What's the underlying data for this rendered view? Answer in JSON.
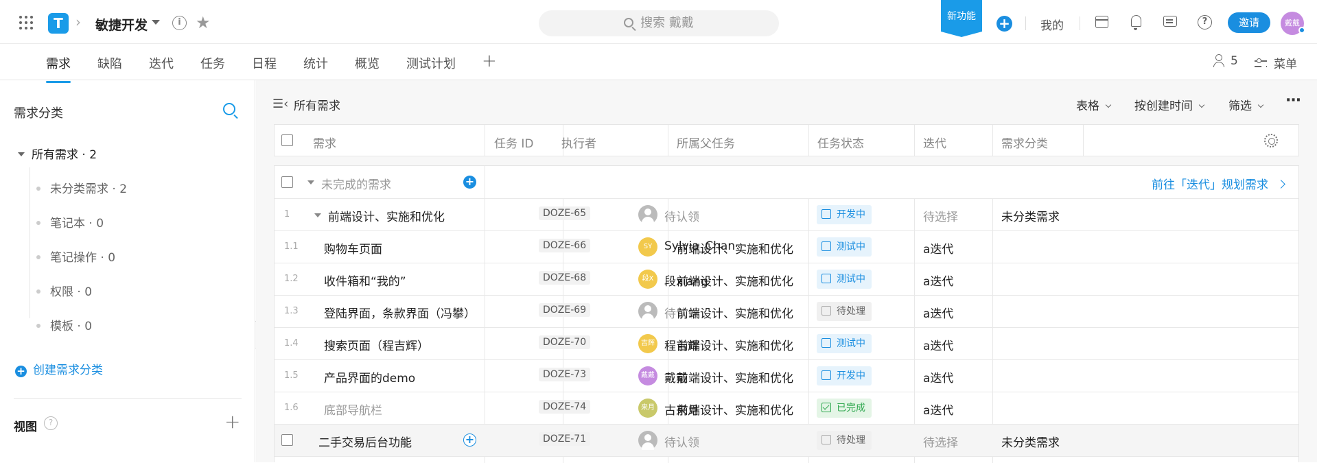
{
  "topbar": {
    "logo_letter": "T",
    "project_name": "敏捷开发",
    "search_placeholder": "搜索 戴戴",
    "new_feature_badge": "新功能",
    "mine_label": "我的",
    "invite_label": "邀请",
    "user_avatar_text": "戴戴"
  },
  "nav": {
    "tabs": [
      "需求",
      "缺陷",
      "迭代",
      "任务",
      "日程",
      "统计",
      "概览",
      "测试计划"
    ],
    "active_tab": "需求",
    "member_count": "5",
    "menu_label": "菜单"
  },
  "sidebar": {
    "title": "需求分类",
    "root": "所有需求 · 2",
    "items": [
      "未分类需求 · 2",
      "笔记本 · 0",
      "笔记操作 · 0",
      "权限 · 0",
      "模板 · 0"
    ],
    "create_label": "创建需求分类",
    "views_label": "视图"
  },
  "main": {
    "title": "所有需求",
    "view_mode": "表格",
    "sort_label": "按创建时间",
    "filter_label": "筛选"
  },
  "table": {
    "columns": [
      "需求",
      "任务 ID",
      "执行者",
      "所属父任务",
      "任务状态",
      "迭代",
      "需求分类"
    ],
    "group_label": "未完成的需求",
    "goto_link": "前往「迭代」规划需求",
    "rows": [
      {
        "num": "1",
        "title": "前端设计、实施和优化",
        "task_id": "DOZE-65",
        "assignee": "待认领",
        "parent": "",
        "status": "开发中",
        "iteration": "待选择",
        "category": "未分类需求"
      },
      {
        "num": "1.1",
        "title": "购物车页面",
        "task_id": "DOZE-66",
        "avatar_text": "SY",
        "assignee": "Sylvia_Chan",
        "parent": "前端设计、实施和优化",
        "status": "测试中",
        "iteration": "a迭代",
        "category": ""
      },
      {
        "num": "1.2",
        "title": "收件箱和“我的”",
        "task_id": "DOZE-68",
        "avatar_text": "段X",
        "assignee": "段xiang",
        "parent": "前端设计、实施和优化",
        "status": "测试中",
        "iteration": "a迭代",
        "category": ""
      },
      {
        "num": "1.3",
        "title": "登陆界面，条款界面（冯攀）",
        "task_id": "DOZE-69",
        "assignee": "待认领",
        "parent": "前端设计、实施和优化",
        "status": "待处理",
        "iteration": "a迭代",
        "category": ""
      },
      {
        "num": "1.4",
        "title": "搜索页面（程吉辉）",
        "task_id": "DOZE-70",
        "avatar_text": "吉辉",
        "assignee": "程吉辉",
        "parent": "前端设计、实施和优化",
        "status": "测试中",
        "iteration": "a迭代",
        "category": ""
      },
      {
        "num": "1.5",
        "title": "产品界面的demo",
        "task_id": "DOZE-73",
        "avatar_text": "戴戴",
        "assignee": "戴戴",
        "parent": "前端设计、实施和优化",
        "status": "开发中",
        "iteration": "a迭代",
        "category": ""
      },
      {
        "num": "1.6",
        "title": "底部导航栏",
        "task_id": "DOZE-74",
        "avatar_text": "来月",
        "assignee": "古来月",
        "parent": "前端设计、实施和优化",
        "status": "已完成",
        "iteration": "a迭代",
        "category": ""
      },
      {
        "num": "",
        "title": "二手交易后台功能",
        "task_id": "DOZE-71",
        "assignee": "待认领",
        "parent": "",
        "status": "待处理",
        "iteration": "待选择",
        "category": "未分类需求"
      }
    ]
  },
  "colors": {
    "accent": "#1a9be8",
    "status_blue": "#1a8ee0",
    "status_green": "#2fa84f",
    "avatar_yellow": "#f2c94c",
    "avatar_purple": "#c58be0",
    "avatar_olive": "#c9c96a"
  }
}
